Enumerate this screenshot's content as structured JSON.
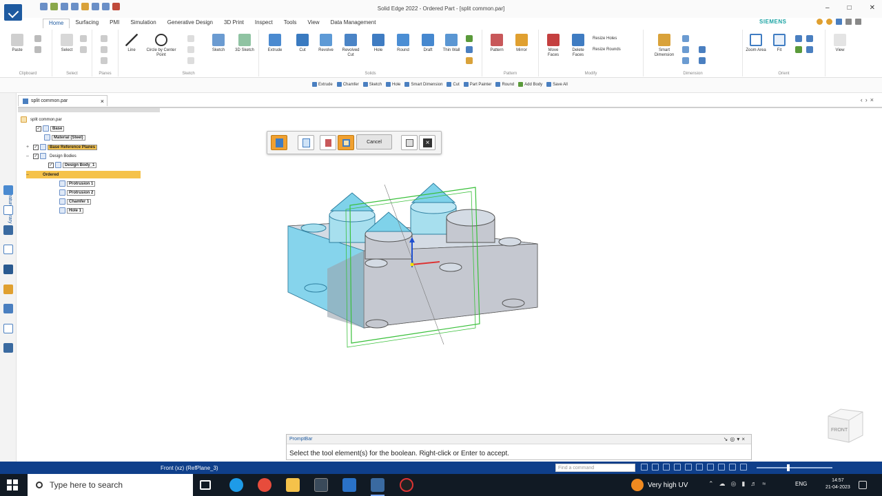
{
  "app": {
    "title": "Solid Edge 2022 - Ordered Part - [split common.par]",
    "brand": "SIEMENS",
    "accent": "#1e5aa0"
  },
  "menu_tabs": [
    "Home",
    "Surfacing",
    "PMI",
    "Simulation",
    "Generative Design",
    "3D Print",
    "Inspect",
    "Tools",
    "View",
    "Data Management"
  ],
  "ribbon": {
    "groups": [
      "Clipboard",
      "Select",
      "Planes",
      "Sketch",
      "Solids",
      "Pattern",
      "Modify",
      "Dimension",
      "Orient"
    ],
    "buttons": {
      "paste": "Paste",
      "select": "Select",
      "line": "Line",
      "circle": "Circle by Center Point",
      "sketch": "Sketch",
      "sketch3d": "3D Sketch",
      "extrude": "Extrude",
      "cut": "Cut",
      "revolve": "Revolve",
      "revolved_cut": "Revolved Cut",
      "hole": "Hole",
      "round": "Round",
      "draft": "Draft",
      "thin_wall": "Thin Wall",
      "pattern": "Pattern",
      "mirror": "Mirror",
      "move_faces": "Move Faces",
      "delete_faces": "Delete Faces",
      "resize_holes": "Resize Holes",
      "resize_rounds": "Resize Rounds",
      "smart_dimension": "Smart Dimension",
      "zoom_area": "Zoom Area",
      "fit": "Fit",
      "view": "View"
    }
  },
  "command_bar": [
    "Extrude",
    "Chamfer",
    "Sketch",
    "Hole",
    "Smart Dimension",
    "Cut",
    "Part Painter",
    "Round",
    "Add Body",
    "Save All"
  ],
  "side_panel": {
    "label": "Feature Library",
    "doc_tab": "split common.par"
  },
  "tree": [
    {
      "label": "split common.par"
    },
    {
      "label": "Base"
    },
    {
      "label": "Material (Steel)"
    },
    {
      "label": "Base Reference Planes"
    },
    {
      "label": "Design Bodies"
    },
    {
      "label": "Design Body_1"
    },
    {
      "label": "Ordered"
    },
    {
      "label": "Protrusion 1"
    },
    {
      "label": "Protrusion 2"
    },
    {
      "label": "Chamfer 1"
    },
    {
      "label": "Hole 1"
    }
  ],
  "command_panel": {
    "cancel": "Cancel"
  },
  "prompt": {
    "header": "PromptBar",
    "text": "Select the tool element(s) for the boolean.  Right-click or Enter to accept."
  },
  "status": {
    "text": "Front (xz) (RefPlane_3)",
    "find_placeholder": "Find a command"
  },
  "taskbar": {
    "search_placeholder": "Type here to search",
    "weather": "Very high UV",
    "language": "ENG",
    "time": "14:57",
    "date": "21-04-2023"
  },
  "view_cube": {
    "label": "FRONT"
  }
}
